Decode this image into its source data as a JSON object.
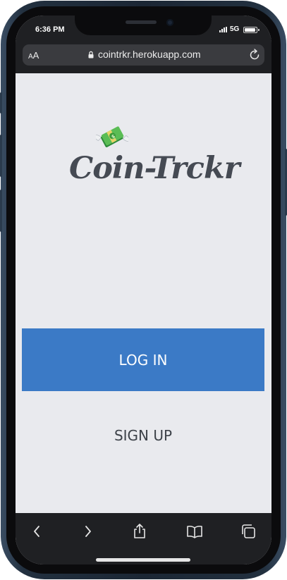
{
  "status_bar": {
    "time": "6:36 PM",
    "network": "5G"
  },
  "browser": {
    "aa_label_small": "A",
    "aa_label": "A",
    "url": "cointrkr.herokuapp.com"
  },
  "app": {
    "logo_text": "Coin-Trckr",
    "login_label": "LOG IN",
    "signup_label": "SIGN UP"
  },
  "toolbar": {
    "icons": [
      "back-icon",
      "forward-icon",
      "share-icon",
      "bookmarks-icon",
      "tabs-icon"
    ]
  },
  "colors": {
    "accent": "#3b7ac6",
    "background": "#e9eaee",
    "browser_chrome": "#1f2023",
    "logo": "#454a53"
  }
}
